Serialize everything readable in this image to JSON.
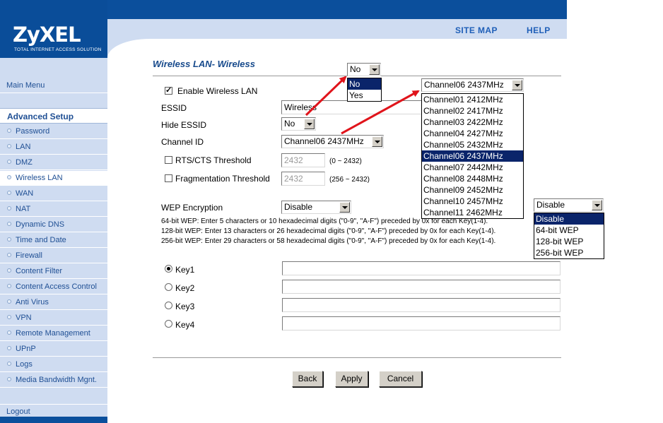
{
  "brand": {
    "name": "ZyXEL",
    "tagline": "TOTAL INTERNET ACCESS SOLUTION"
  },
  "header": {
    "site_map": "SITE MAP",
    "help": "HELP"
  },
  "sidebar": {
    "main_menu": "Main Menu",
    "section": "Advanced Setup",
    "items": [
      "Password",
      "LAN",
      "DMZ",
      "Wireless LAN",
      "WAN",
      "NAT",
      "Dynamic DNS",
      "Time and Date",
      "Firewall",
      "Content Filter",
      "Content Access Control",
      "Anti Virus",
      "VPN",
      "Remote Management",
      "UPnP",
      "Logs",
      "Media Bandwidth Mgnt."
    ],
    "active": "Wireless LAN",
    "logout": "Logout"
  },
  "page": {
    "title": "Wireless LAN- Wireless"
  },
  "form": {
    "enable_label": "Enable Wireless LAN",
    "enable_checked": true,
    "essid_label": "ESSID",
    "essid_value": "Wireless",
    "hide_label": "Hide ESSID",
    "hide_value": "No",
    "channel_label": "Channel ID",
    "channel_value": "Channel06 2437MHz",
    "rts_label": "RTS/CTS Threshold",
    "rts_value": "2432",
    "rts_range": "(0 ~ 2432)",
    "frag_label": "Fragmentation Threshold",
    "frag_value": "2432",
    "frag_range": "(256 ~ 2432)",
    "wep_label": "WEP Encryption",
    "wep_value": "Disable",
    "wep_notes": [
      "64-bit WEP: Enter 5 characters or 10 hexadecimal digits (\"0-9\", \"A-F\") preceded by 0x for each Key(1-4).",
      "128-bit WEP: Enter 13 characters or 26 hexadecimal digits (\"0-9\", \"A-F\") preceded by 0x for each Key(1-4).",
      "256-bit WEP: Enter 29 characters or 58 hexadecimal digits (\"0-9\", \"A-F\") preceded by 0x for each Key(1-4)."
    ],
    "keys": [
      "Key1",
      "Key2",
      "Key3",
      "Key4"
    ],
    "selected_key": "Key1"
  },
  "popup_hide": {
    "value": "No",
    "options": [
      "No",
      "Yes"
    ],
    "highlighted": "No"
  },
  "popup_channel": {
    "value": "Channel06 2437MHz",
    "options": [
      "Channel01 2412MHz",
      "Channel02 2417MHz",
      "Channel03 2422MHz",
      "Channel04 2427MHz",
      "Channel05 2432MHz",
      "Channel06 2437MHz",
      "Channel07 2442MHz",
      "Channel08 2448MHz",
      "Channel09 2452MHz",
      "Channel10 2457MHz",
      "Channel11 2462MHz"
    ],
    "highlighted": "Channel06 2437MHz"
  },
  "popup_wep": {
    "value": "Disable",
    "options": [
      "Disable",
      "64-bit WEP",
      "128-bit WEP",
      "256-bit WEP"
    ],
    "highlighted": "Disable"
  },
  "buttons": {
    "back": "Back",
    "apply": "Apply",
    "cancel": "Cancel"
  },
  "colors": {
    "brand_blue": "#0b4f9c",
    "sidebar_bg": "#cfdcf1",
    "link_blue": "#1f5fb8",
    "arrow_red": "#e0141b",
    "highlight": "#0a246a"
  }
}
